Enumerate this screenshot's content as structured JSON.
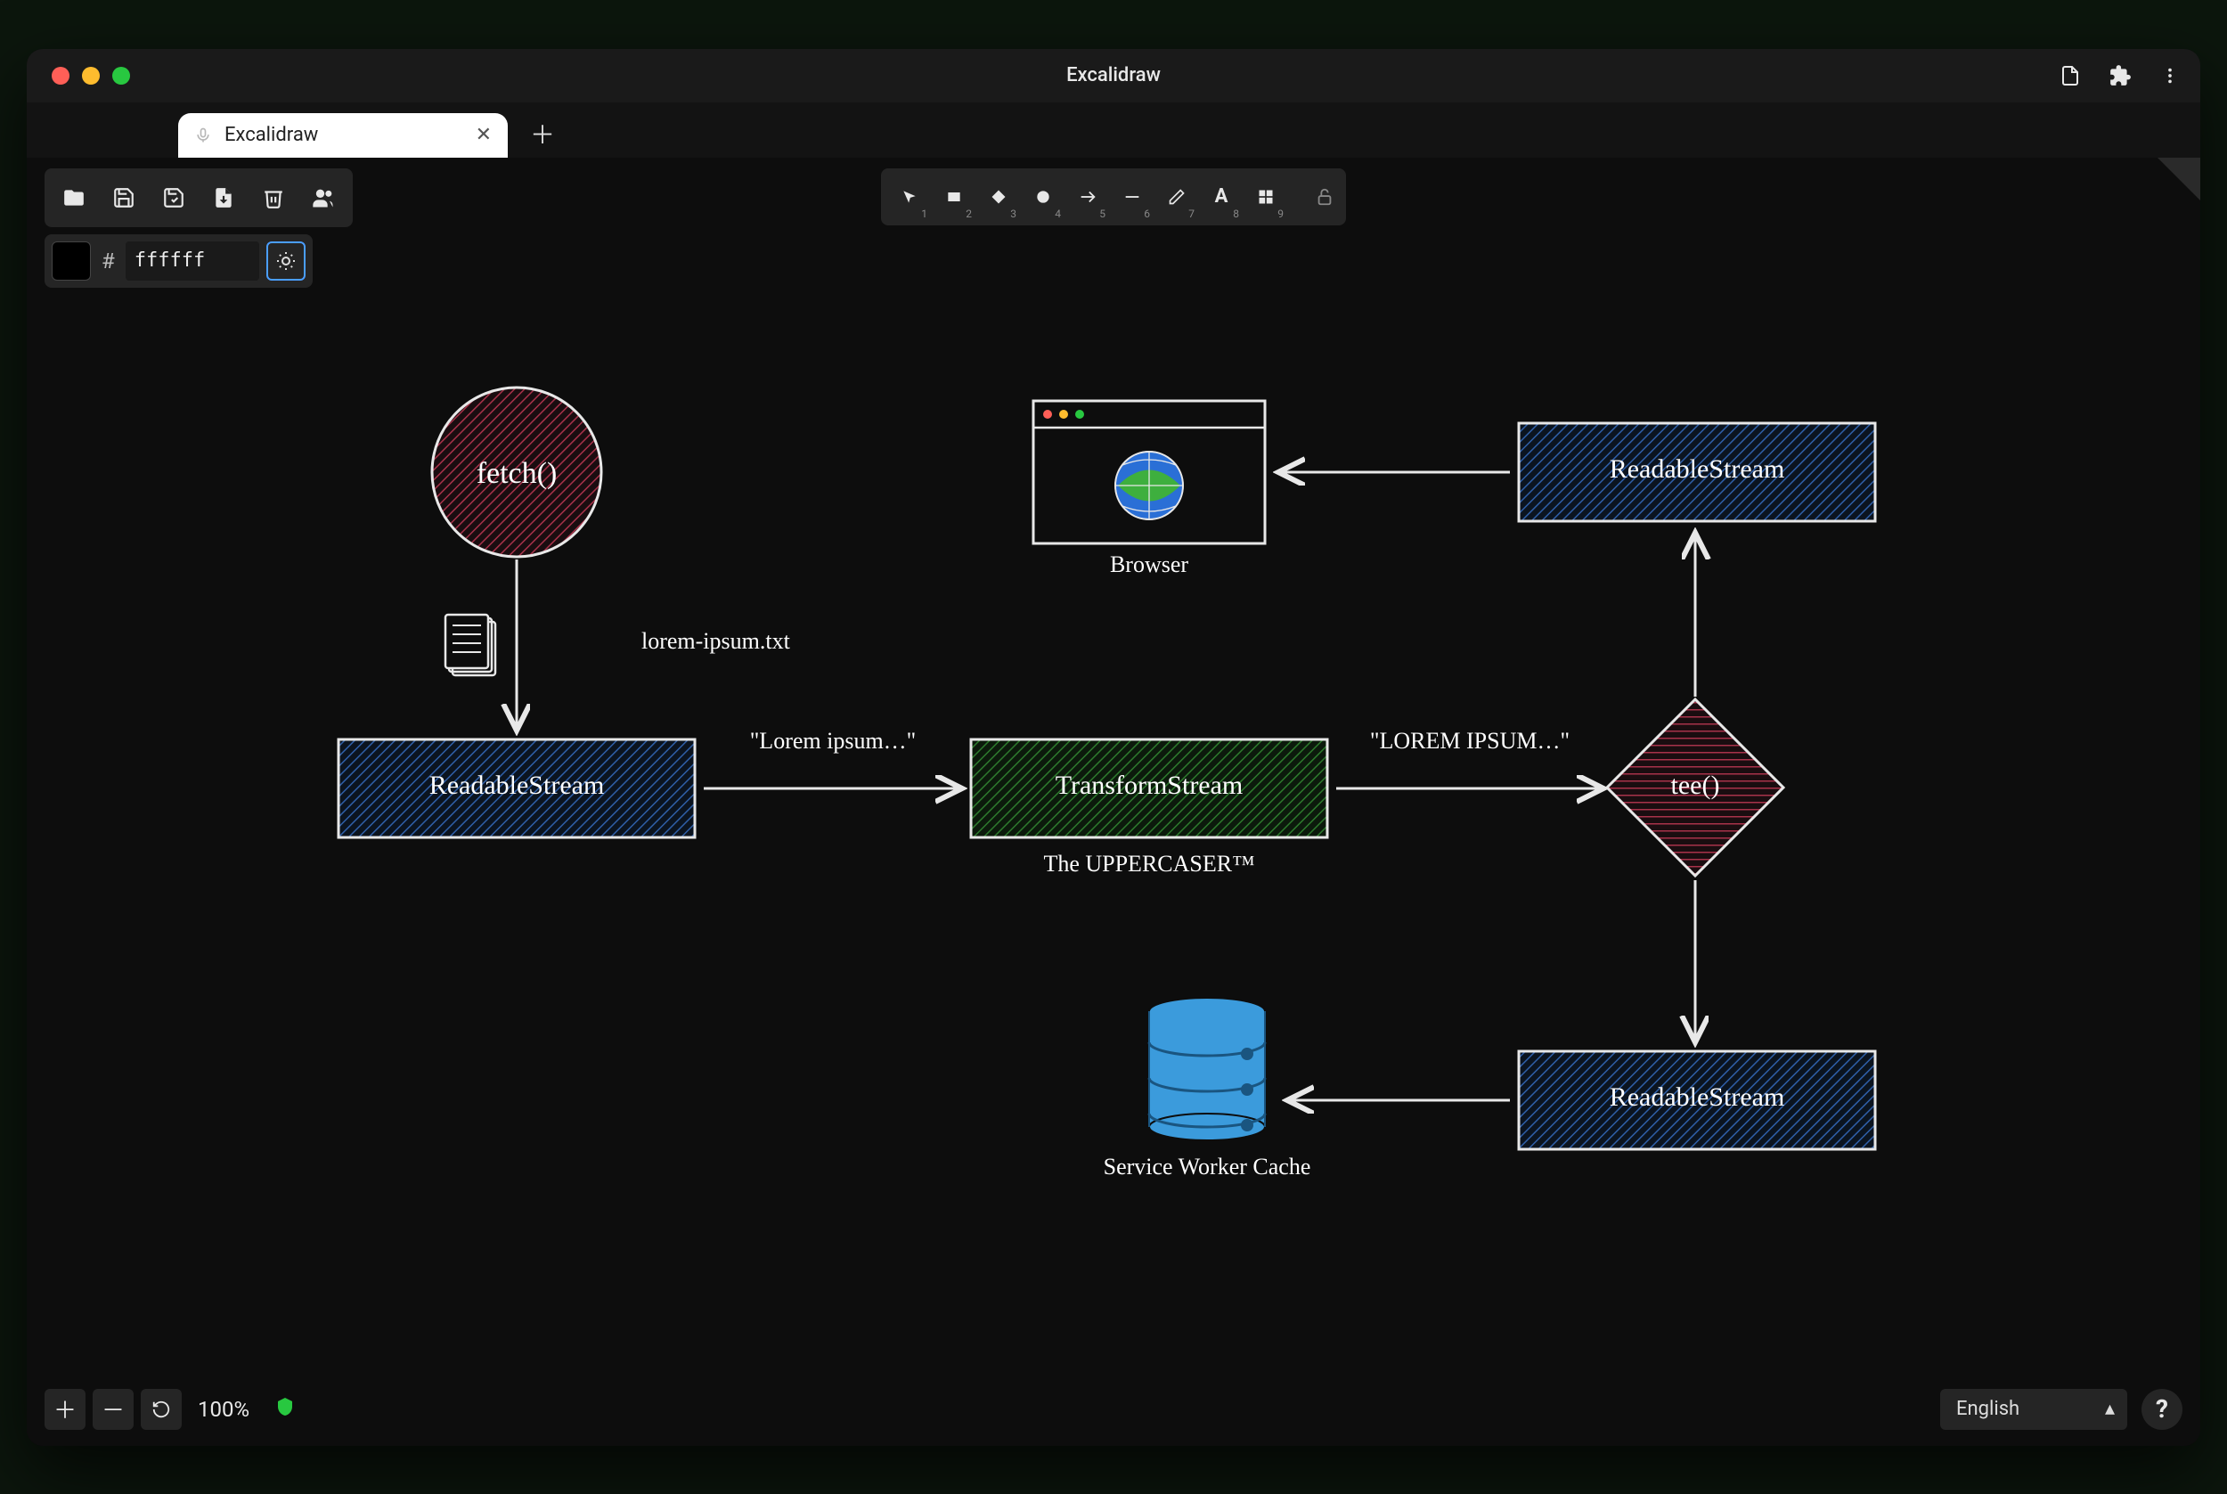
{
  "window": {
    "title": "Excalidraw",
    "tab_title": "Excalidraw"
  },
  "color_panel": {
    "hash": "#",
    "value": "ffffff"
  },
  "tools": [
    {
      "name": "selection",
      "num": "1"
    },
    {
      "name": "rectangle",
      "num": "2"
    },
    {
      "name": "diamond",
      "num": "3"
    },
    {
      "name": "ellipse",
      "num": "4"
    },
    {
      "name": "arrow",
      "num": "5"
    },
    {
      "name": "line",
      "num": "6"
    },
    {
      "name": "draw",
      "num": "7"
    },
    {
      "name": "text",
      "num": "8"
    },
    {
      "name": "library",
      "num": "9"
    }
  ],
  "zoom": {
    "percent": "100%"
  },
  "language": {
    "selected": "English"
  },
  "diagram": {
    "nodes": {
      "fetch": "fetch()",
      "file_label": "lorem-ipsum.txt",
      "readable1": "ReadableStream",
      "transform": "TransformStream",
      "transform_sub": "The UPPERCASER™",
      "tee": "tee()",
      "readable2": "ReadableStream",
      "readable3": "ReadableStream",
      "browser": "Browser",
      "cache": "Service Worker Cache"
    },
    "edges": {
      "lorem_lower": "\"Lorem ipsum…\"",
      "lorem_upper": "\"LOREM IPSUM…\""
    }
  }
}
